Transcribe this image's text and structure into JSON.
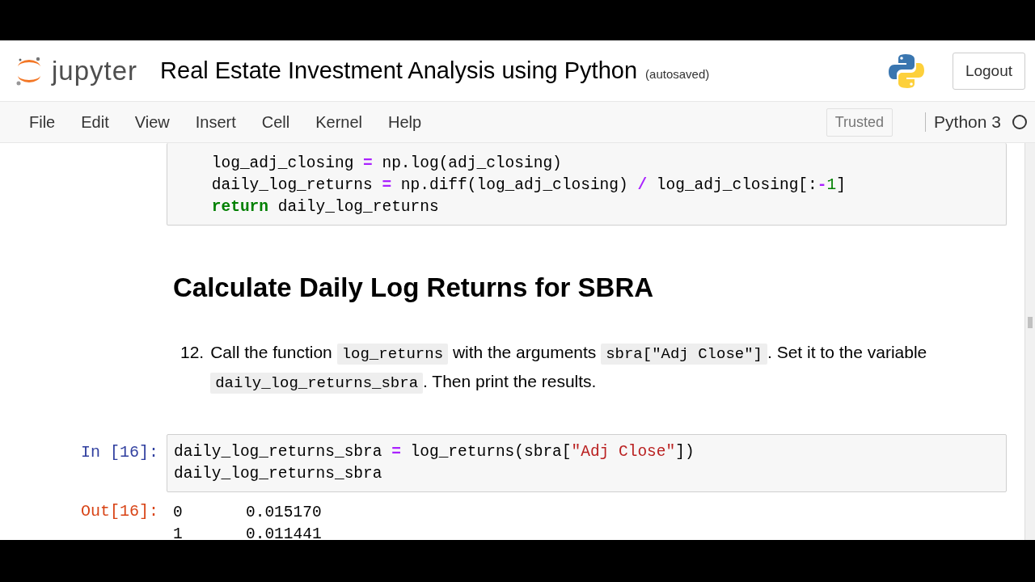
{
  "header": {
    "logo_text": "jupyter",
    "notebook_title": "Real Estate Investment Analysis using Python",
    "save_status": "(autosaved)",
    "logout": "Logout"
  },
  "menu": {
    "items": [
      "File",
      "Edit",
      "View",
      "Insert",
      "Cell",
      "Kernel",
      "Help"
    ],
    "trusted": "Trusted",
    "kernel": "Python 3"
  },
  "cells": [
    {
      "kind": "code",
      "lines": [
        [
          {
            "text": "    log_adj_closing ",
            "kind": "plain"
          },
          {
            "text": "=",
            "kind": "op"
          },
          {
            "text": " np.log(adj_closing)",
            "kind": "plain"
          }
        ],
        [
          {
            "text": "    daily_log_returns ",
            "kind": "plain"
          },
          {
            "text": "=",
            "kind": "op"
          },
          {
            "text": " np.diff(log_adj_closing) ",
            "kind": "plain"
          },
          {
            "text": "/",
            "kind": "op"
          },
          {
            "text": " log_adj_closing[:",
            "kind": "plain"
          },
          {
            "text": "-",
            "kind": "op"
          },
          {
            "text": "1",
            "kind": "num"
          },
          {
            "text": "]",
            "kind": "plain"
          }
        ],
        [
          {
            "text": "    return",
            "kind": "kw"
          },
          {
            "text": " daily_log_returns",
            "kind": "plain"
          }
        ]
      ]
    },
    {
      "kind": "heading",
      "text": "Calculate Daily Log Returns for SBRA"
    },
    {
      "kind": "list",
      "number": "12.",
      "parts": [
        {
          "text": "Call the function ",
          "kind": "text"
        },
        {
          "text": "log_returns",
          "kind": "code"
        },
        {
          "text": " with the arguments ",
          "kind": "text"
        },
        {
          "text": "sbra[\"Adj Close\"]",
          "kind": "code"
        },
        {
          "text": ". Set it to the variable ",
          "kind": "text"
        },
        {
          "text": "daily_log_returns_sbra",
          "kind": "code"
        },
        {
          "text": ". Then print the results.",
          "kind": "text"
        }
      ]
    },
    {
      "kind": "code",
      "prompt": "In [16]:",
      "lines": [
        [
          {
            "text": "daily_log_returns_sbra ",
            "kind": "plain"
          },
          {
            "text": "=",
            "kind": "op"
          },
          {
            "text": " log_returns(sbra[",
            "kind": "plain"
          },
          {
            "text": "\"Adj Close\"",
            "kind": "str"
          },
          {
            "text": "])",
            "kind": "plain"
          }
        ],
        [
          {
            "text": "daily_log_returns_sbra",
            "kind": "plain"
          }
        ]
      ]
    },
    {
      "kind": "output",
      "prompt": "Out[16]:",
      "rows": [
        [
          "0",
          "0.015170"
        ],
        [
          "1",
          "0.011441"
        ]
      ]
    }
  ]
}
